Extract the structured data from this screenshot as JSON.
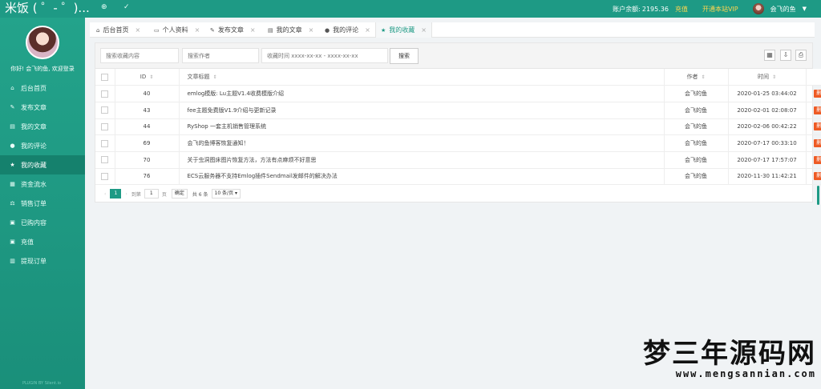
{
  "app": {
    "logo_text": "米饭 ( ゜- ゜)...",
    "balance_label": "账户余额:",
    "balance_value": "2195.36",
    "recharge_link": "充值",
    "vip_link": "开通本站VIP",
    "user_name": "会飞的鱼"
  },
  "sidebar": {
    "welcome": "你好! 会飞的鱼, 欢迎登录",
    "items": [
      {
        "icon": "home-icon",
        "label": "后台首页"
      },
      {
        "icon": "edit-icon",
        "label": "发布文章"
      },
      {
        "icon": "book-icon",
        "label": "我的文章"
      },
      {
        "icon": "comments-icon",
        "label": "我的评论"
      },
      {
        "icon": "star-icon",
        "label": "我的收藏"
      },
      {
        "icon": "calculator-icon",
        "label": "资金流水"
      },
      {
        "icon": "scale-icon",
        "label": "销售订单"
      },
      {
        "icon": "bag-icon",
        "label": "已购内容"
      },
      {
        "icon": "bag-icon",
        "label": "充值"
      },
      {
        "icon": "bank-icon",
        "label": "提现订单"
      }
    ],
    "active_index": 4,
    "footer": "PLUGIN BY Silent.io"
  },
  "tabs": [
    {
      "icon": "home-icon",
      "label": "后台首页"
    },
    {
      "icon": "id-card-icon",
      "label": "个人资料"
    },
    {
      "icon": "edit-icon",
      "label": "发布文章"
    },
    {
      "icon": "book-icon",
      "label": "我的文章"
    },
    {
      "icon": "comments-icon",
      "label": "我的评论"
    },
    {
      "icon": "star-icon",
      "label": "我的收藏"
    }
  ],
  "search": {
    "content_placeholder": "搜索收藏内容",
    "author_placeholder": "搜索作者",
    "time_placeholder": "收藏时间 xxxx-xx-xx - xxxx-xx-xx",
    "button": "搜索"
  },
  "table": {
    "headers": {
      "id": "ID",
      "title": "文章标题",
      "author": "作者",
      "time": "时间"
    },
    "delete_label": "删除",
    "rows": [
      {
        "id": "40",
        "title": "emlog模版: Lu主题V1.4收费模版介绍",
        "author": "会飞的鱼",
        "time": "2020-01-25 03:44:02"
      },
      {
        "id": "43",
        "title": "fee主题免费版V1.9介绍与更新记录",
        "author": "会飞的鱼",
        "time": "2020-02-01 02:08:07"
      },
      {
        "id": "44",
        "title": "RyShop 一套主机销售管理系统",
        "author": "会飞的鱼",
        "time": "2020-02-06 00:42:22"
      },
      {
        "id": "69",
        "title": "会飞的鱼博客恢复通知！",
        "author": "会飞的鱼",
        "time": "2020-07-17 00:33:10"
      },
      {
        "id": "70",
        "title": "关于虫洞图床图片恢复方法，方法有点麻烦不好意思",
        "author": "会飞的鱼",
        "time": "2020-07-17 17:57:07"
      },
      {
        "id": "76",
        "title": "ECS云服务器不支持Emlog插件Sendmail发邮件的解决办法",
        "author": "会飞的鱼",
        "time": "2020-11-30 11:42:21"
      }
    ]
  },
  "pager": {
    "current_page": "1",
    "goto_label": "到第",
    "page_input": "1",
    "page_unit": "页",
    "confirm": "确定",
    "total": "共 6 条",
    "page_size": "10 条/页"
  },
  "watermark": {
    "title": "梦三年源码网",
    "url": "www.mengsannian.com"
  },
  "colors": {
    "primary": "#1e9a85",
    "danger": "#ee5a24",
    "warning": "#ffd54f"
  }
}
